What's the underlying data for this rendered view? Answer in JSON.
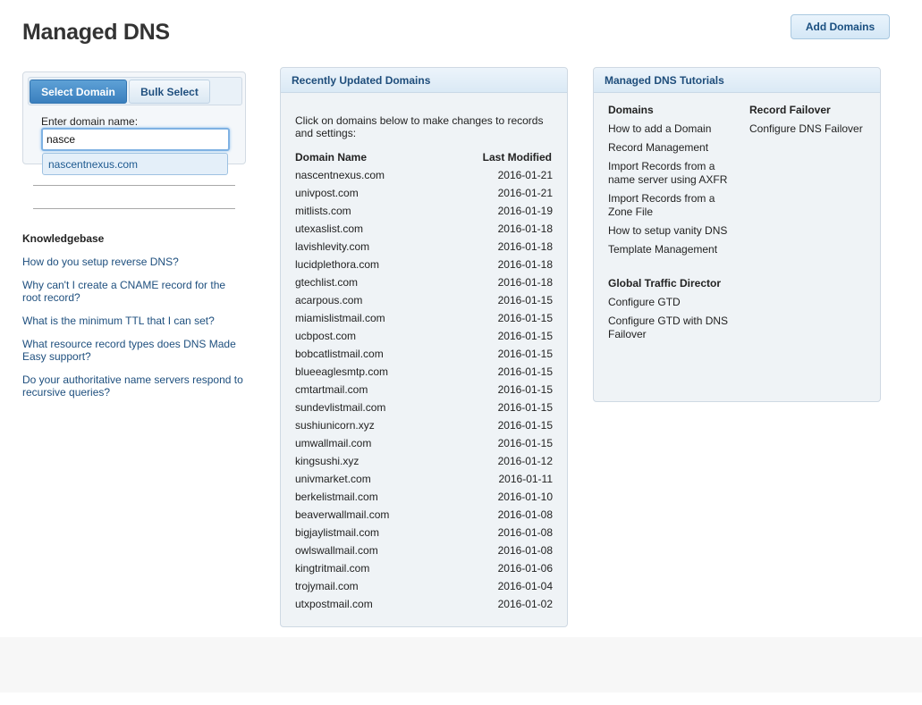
{
  "title": "Managed DNS",
  "add_domains_label": "Add Domains",
  "select": {
    "tab_select": "Select Domain",
    "tab_bulk": "Bulk Select",
    "enter_label": "Enter domain name:",
    "input_value": "nasce",
    "suggestion": "nascentnexus.com"
  },
  "knowledgebase": {
    "title": "Knowledgebase",
    "links": [
      "How do you setup reverse DNS?",
      "Why can't I create a CNAME record for the root record?",
      "What is the minimum TTL that I can set?",
      "What resource record types does DNS Made Easy support?",
      "Do your authoritative name servers respond to recursive queries?"
    ]
  },
  "recent": {
    "title": "Recently Updated Domains",
    "intro": "Click on domains below to make changes to records and settings:",
    "col_domain": "Domain Name",
    "col_modified": "Last Modified",
    "rows": [
      {
        "domain": "nascentnexus.com",
        "modified": "2016-01-21"
      },
      {
        "domain": "univpost.com",
        "modified": "2016-01-21"
      },
      {
        "domain": "mitlists.com",
        "modified": "2016-01-19"
      },
      {
        "domain": "utexaslist.com",
        "modified": "2016-01-18"
      },
      {
        "domain": "lavishlevity.com",
        "modified": "2016-01-18"
      },
      {
        "domain": "lucidplethora.com",
        "modified": "2016-01-18"
      },
      {
        "domain": "gtechlist.com",
        "modified": "2016-01-18"
      },
      {
        "domain": "acarpous.com",
        "modified": "2016-01-15"
      },
      {
        "domain": "miamislistmail.com",
        "modified": "2016-01-15"
      },
      {
        "domain": "ucbpost.com",
        "modified": "2016-01-15"
      },
      {
        "domain": "bobcatlistmail.com",
        "modified": "2016-01-15"
      },
      {
        "domain": "blueeaglesmtp.com",
        "modified": "2016-01-15"
      },
      {
        "domain": "cmtartmail.com",
        "modified": "2016-01-15"
      },
      {
        "domain": "sundevlistmail.com",
        "modified": "2016-01-15"
      },
      {
        "domain": "sushiunicorn.xyz",
        "modified": "2016-01-15"
      },
      {
        "domain": "umwallmail.com",
        "modified": "2016-01-15"
      },
      {
        "domain": "kingsushi.xyz",
        "modified": "2016-01-12"
      },
      {
        "domain": "univmarket.com",
        "modified": "2016-01-11"
      },
      {
        "domain": "berkelistmail.com",
        "modified": "2016-01-10"
      },
      {
        "domain": "beaverwallmail.com",
        "modified": "2016-01-08"
      },
      {
        "domain": "bigjaylistmail.com",
        "modified": "2016-01-08"
      },
      {
        "domain": "owlswallmail.com",
        "modified": "2016-01-08"
      },
      {
        "domain": "kingtritmail.com",
        "modified": "2016-01-06"
      },
      {
        "domain": "trojymail.com",
        "modified": "2016-01-04"
      },
      {
        "domain": "utxpostmail.com",
        "modified": "2016-01-02"
      }
    ]
  },
  "tutorials": {
    "title": "Managed DNS Tutorials",
    "domains_heading": "Domains",
    "domains_links": [
      "How to add a Domain",
      "Record Management",
      "Import Records from a name server using AXFR",
      "Import Records from a Zone File",
      "How to setup vanity DNS",
      "Template Management"
    ],
    "gtd_heading": "Global Traffic Director",
    "gtd_links": [
      "Configure GTD",
      "Configure GTD with DNS Failover"
    ],
    "failover_heading": "Record Failover",
    "failover_links": [
      "Configure DNS Failover"
    ]
  }
}
